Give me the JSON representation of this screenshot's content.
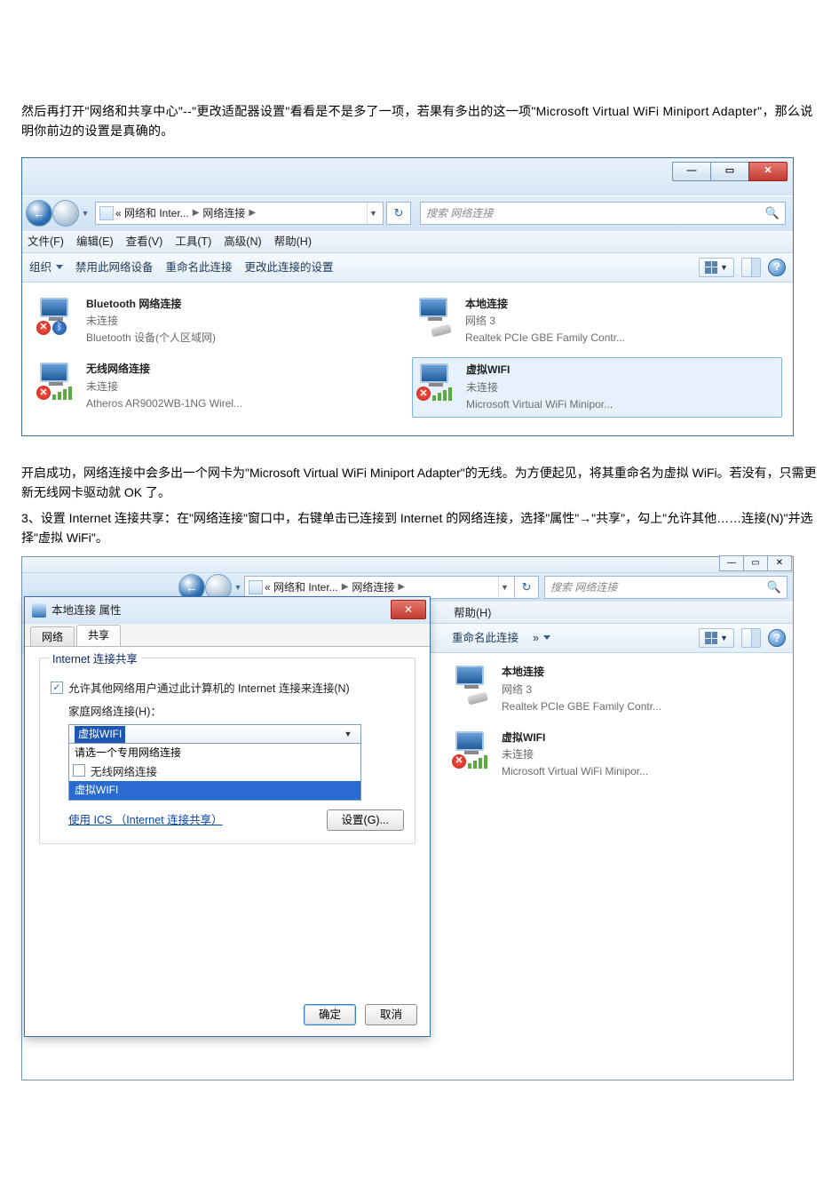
{
  "paragraph1": "然后再打开\"网络和共享中心\"--\"更改适配器设置\"看看是不是多了一项，若果有多出的这一项\"Microsoft Virtual WiFi Miniport Adapter\"，那么说明你前边的设置是真确的。",
  "paragraph2": "开启成功，网络连接中会多出一个网卡为\"Microsoft Virtual WiFi Miniport Adapter\"的无线。为方便起见，将其重命名为虚拟 WiFi。若没有，只需更新无线网卡驱动就 OK 了。",
  "paragraph3": "3、设置 Internet 连接共享：在\"网络连接\"窗口中，右键单击已连接到 Internet 的网络连接，选择\"属性\"→\"共享\"，勾上\"允许其他……连接(N)\"并选择\"虚拟 WiFi\"。",
  "win1": {
    "breadcrumb": {
      "seg1": "« 网络和 Inter...",
      "seg2": "网络连接"
    },
    "search_placeholder": "搜索 网络连接",
    "menu": [
      "文件(F)",
      "编辑(E)",
      "查看(V)",
      "工具(T)",
      "高级(N)",
      "帮助(H)"
    ],
    "toolbar": {
      "organize": "组织",
      "disable": "禁用此网络设备",
      "rename": "重命名此连接",
      "change": "更改此连接的设置"
    },
    "items": [
      {
        "title": "Bluetooth 网络连接",
        "status": "未连接",
        "detail": "Bluetooth 设备(个人区域网)",
        "type": "bt"
      },
      {
        "title": "本地连接",
        "status": "网络 3",
        "detail": "Realtek PCIe GBE Family Contr...",
        "type": "lan"
      },
      {
        "title": "无线网络连接",
        "status": "未连接",
        "detail": "Atheros AR9002WB-1NG Wirel...",
        "type": "wifix"
      },
      {
        "title": "虚拟WIFI",
        "status": "未连接",
        "detail": "Microsoft Virtual WiFi Minipor...",
        "type": "wifix",
        "selected": true
      }
    ]
  },
  "win2": {
    "breadcrumb": {
      "seg1": "« 网络和 Inter...",
      "seg2": "网络连接"
    },
    "search_placeholder": "搜索 网络连接",
    "menu_help": "帮助(H)",
    "toolbar": {
      "rename": "重命名此连接",
      "more": "»"
    },
    "items": [
      {
        "title": "本地连接",
        "status": "网络 3",
        "detail": "Realtek PCIe GBE Family Contr...",
        "type": "lan"
      },
      {
        "title": "虚拟WIFI",
        "status": "未连接",
        "detail": "Microsoft Virtual WiFi Minipor...",
        "type": "wifix"
      }
    ]
  },
  "props": {
    "title": "本地连接 属性",
    "tab_network": "网络",
    "tab_share": "共享",
    "group": "Internet 连接共享",
    "allow_label": "允许其他网络用户通过此计算机的 Internet 连接来连接(N)",
    "home_label": "家庭网络连接(H)：",
    "dd_selected": "虚拟WIFI",
    "dd_opts": [
      "请选一个专用网络连接",
      "无线网络连接",
      "虚拟WIFI"
    ],
    "allow_control": "",
    "ics_link": "使用 ICS （Internet 连接共享）",
    "settings_btn": "设置(G)...",
    "ok": "确定",
    "cancel": "取消"
  }
}
